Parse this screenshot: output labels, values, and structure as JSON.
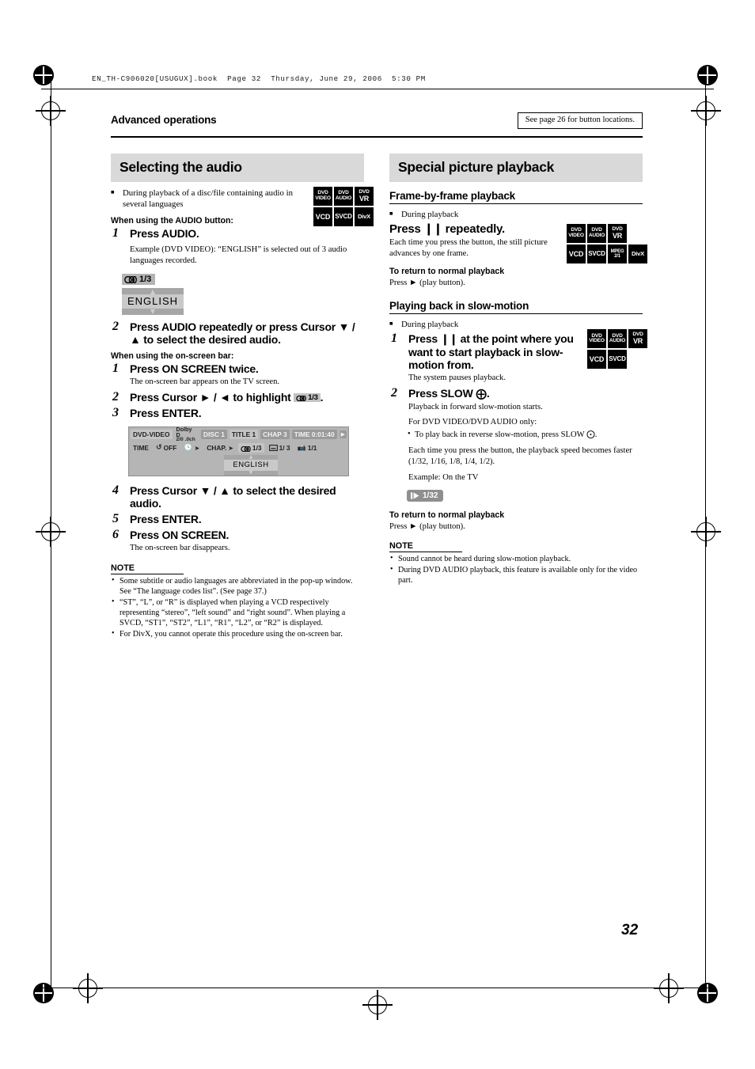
{
  "running_header": "EN_TH-C906020[USUGUX].book  Page 32  Thursday, June 29, 2006  5:30 PM",
  "page_number": "32",
  "header": {
    "chapter_title": "Advanced operations",
    "see_page_note": "See page 26 for button locations."
  },
  "left_column": {
    "banner": "Selecting the audio",
    "intro_bullet": "During playback of a disc/file containing audio in several languages",
    "badges": [
      [
        {
          "l1": "DVD",
          "l2": "VIDEO"
        },
        {
          "l1": "DVD",
          "l2": "AUDIO"
        },
        {
          "l1": "DVD",
          "l2": "VR"
        }
      ],
      [
        {
          "l1": "VCD"
        },
        {
          "l1": "SVCD"
        },
        {
          "l1": "DivX"
        }
      ]
    ],
    "audio_button_head": "When using the AUDIO button:",
    "step1_num": "1",
    "step1_text": "Press AUDIO.",
    "step1_example": "Example (DVD VIDEO): “ENGLISH” is selected out of 3 audio languages recorded.",
    "osd_example": {
      "chip_value": "1/3",
      "popup_value": "ENGLISH"
    },
    "step2_num": "2",
    "step2_text": "Press AUDIO repeatedly or press Cursor ▼ / ▲ to select the desired audio.",
    "onscreen_bar_head": "When using the on-screen bar:",
    "step_osb1_num": "1",
    "step_osb1_text": "Press ON SCREEN twice.",
    "step_osb1_sub": "The on-screen bar appears on the TV screen.",
    "step_osb2_num": "2",
    "step_osb2_text_a": "Press Cursor ► / ◄ to highlight",
    "step_osb2_chip": "1/3",
    "step_osb2_text_b": ".",
    "step_osb3_num": "3",
    "step_osb3_text": "Press ENTER.",
    "onscreen_bar_figure": {
      "disc_type": "DVD-VIDEO",
      "dolby_line1": "Dolby D",
      "dolby_line2": "2/0 .0ch",
      "disc": "DISC 1",
      "title": "TITLE  1",
      "chapter": "CHAP   3",
      "time_label": "TIME",
      "time_value": "0:01:40",
      "row2_time": "TIME",
      "row2_repeat": "OFF",
      "row2_chapter": "CHAP.",
      "row2_audio": "1/3",
      "row2_subtitle": "1/ 3",
      "row2_angle": "1/1",
      "popup_value": "ENGLISH"
    },
    "step_osb4_num": "4",
    "step_osb4_text": "Press Cursor ▼ / ▲ to select the desired audio.",
    "step_osb5_num": "5",
    "step_osb5_text": "Press ENTER.",
    "step_osb6_num": "6",
    "step_osb6_text": "Press ON SCREEN.",
    "step_osb6_sub": "The on-screen bar disappears.",
    "note_title": "NOTE",
    "notes": [
      "Some subtitle or audio languages are abbreviated in the pop-up window. See “The language codes list”. (See page 37.)",
      "“ST”, “L”, or “R” is displayed when playing a VCD respectively representing “stereo”, “left sound” and “right sound”. When playing a SVCD, “ST1”, “ST2”, “L1”, “R1”, “L2”, or “R2” is displayed.",
      "For DivX, you cannot operate this procedure using the on-screen bar."
    ]
  },
  "right_column": {
    "banner": "Special picture playback",
    "section1": {
      "subhead": "Frame-by-frame playback",
      "bullet": "During playback",
      "step_text": "Press ▐▐ repeatedly.",
      "step_text_prefix": "Press",
      "step_text_suffix": "repeatedly.",
      "body": "Each time you press the button, the still picture advances by one frame.",
      "badges": [
        [
          {
            "l1": "DVD",
            "l2": "VIDEO"
          },
          {
            "l1": "DVD",
            "l2": "AUDIO"
          },
          {
            "l1": "DVD",
            "l2": "VR"
          }
        ],
        [
          {
            "l1": "VCD"
          },
          {
            "l1": "SVCD"
          },
          {
            "l1": "MPEG",
            "l2": "2/1"
          },
          {
            "l1": "DivX"
          }
        ]
      ],
      "return_head": "To return to normal playback",
      "return_body": "Press ► (play button)."
    },
    "section2": {
      "subhead": "Playing back in slow-motion",
      "bullet": "During playback",
      "step1_num": "1",
      "step1_text_prefix": "Press",
      "step1_text_suffix": "at the point where you want to start playback in slow-motion from.",
      "step1_sub": "The system pauses playback.",
      "badges": [
        [
          {
            "l1": "DVD",
            "l2": "VIDEO"
          },
          {
            "l1": "DVD",
            "l2": "AUDIO"
          },
          {
            "l1": "DVD",
            "l2": "VR"
          }
        ],
        [
          {
            "l1": "VCD"
          },
          {
            "l1": "SVCD"
          }
        ]
      ],
      "step2_num": "2",
      "step2_text_prefix": "Press SLOW",
      "step2_text_suffix": ".",
      "step2_sub": "Playback in forward slow-motion starts.",
      "para_only_head": "For DVD VIDEO/DVD AUDIO only:",
      "para_only_bullet_a": "To play back in reverse slow-motion, press SLOW",
      "para_only_bullet_b": ".",
      "para_speed": "Each time you press the button, the playback speed becomes faster (1/32, 1/16, 1/8, 1/4, 1/2).",
      "para_example": "Example: On the TV",
      "speed_chip": "1/32",
      "return_head": "To return to normal playback",
      "return_body": "Press ► (play button).",
      "note_title": "NOTE",
      "notes": [
        "Sound cannot be heard during slow-motion playback.",
        "During DVD AUDIO playback, this feature is available only for the video part."
      ]
    }
  }
}
